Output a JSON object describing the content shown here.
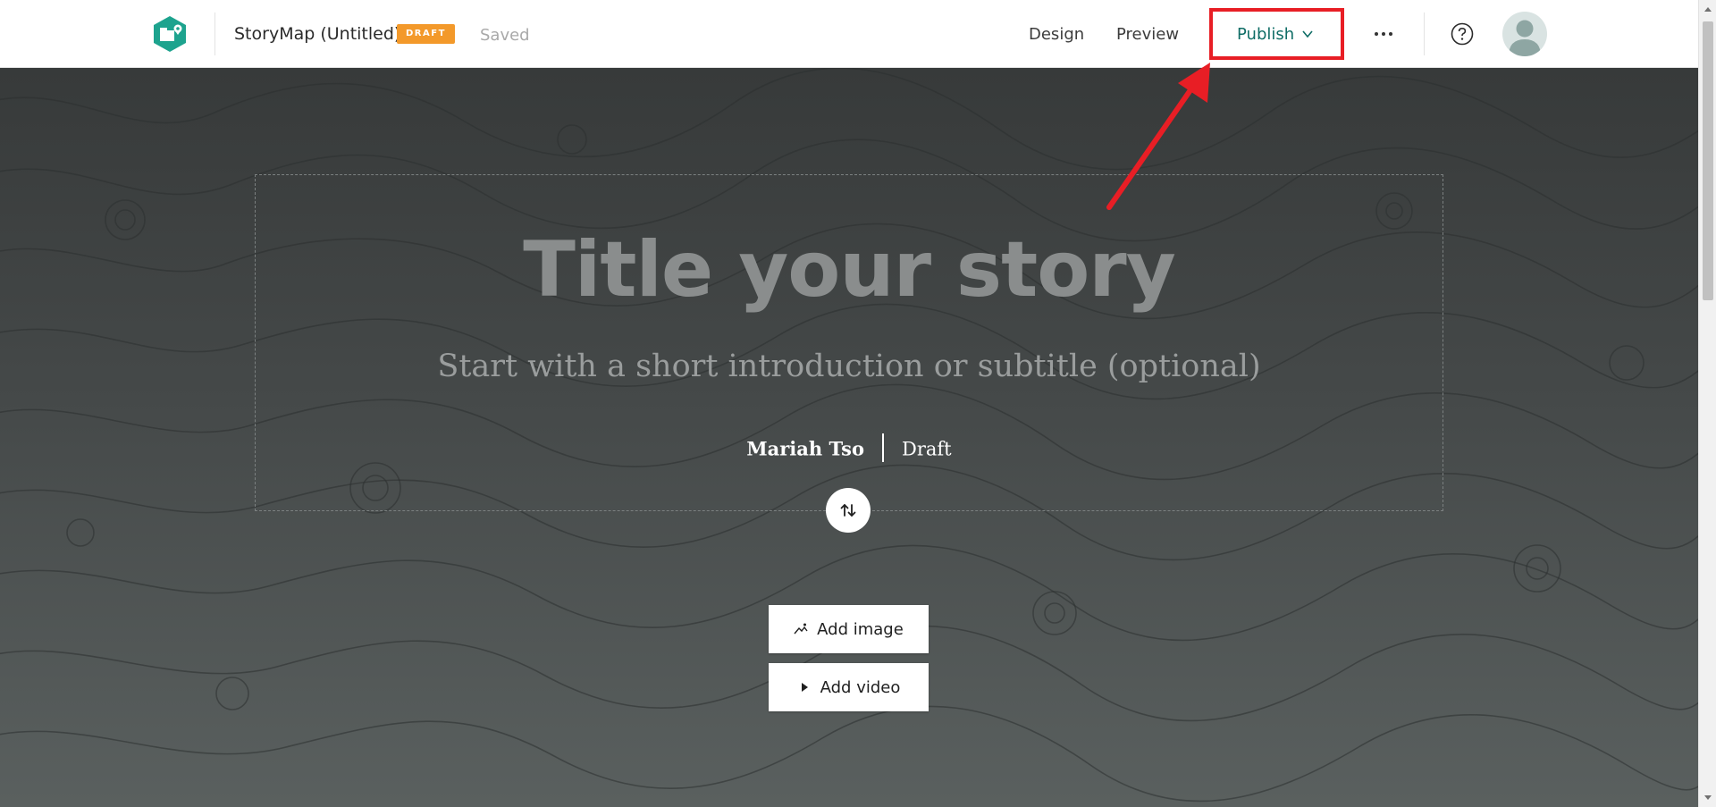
{
  "header": {
    "app_icon": "storymap-icon",
    "story_title": "StoryMap (Untitled)",
    "draft_badge": "DRAFT",
    "save_status": "Saved",
    "nav": {
      "design": "Design",
      "preview": "Preview",
      "publish": "Publish"
    },
    "more_icon": "more-horizontal-icon",
    "help_icon": "help-icon",
    "avatar_icon": "user-avatar-icon"
  },
  "cover": {
    "title_placeholder": "Title your story",
    "subtitle_placeholder": "Start with a short introduction or subtitle (optional)",
    "author": "Mariah Tso",
    "status": "Draft",
    "swap_icon": "swap-vertical-icon",
    "add_image_label": "Add image",
    "add_video_label": "Add video"
  },
  "colors": {
    "accent": "#0f6d66",
    "badge": "#f3992a",
    "highlight": "#e81e25",
    "cover_top": "#373a3a",
    "cover_bottom": "#5a605f"
  }
}
